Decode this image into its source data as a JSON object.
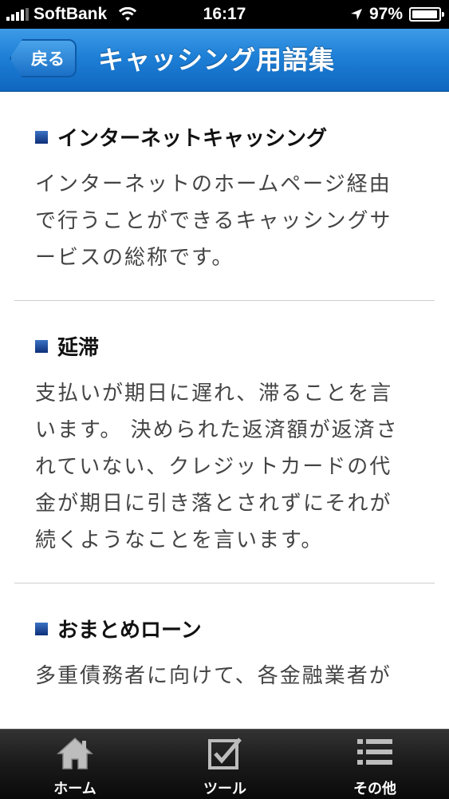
{
  "status_bar": {
    "carrier": "SoftBank",
    "time": "16:17",
    "battery": "97%",
    "battery_level": 0.97
  },
  "nav_bar": {
    "back_label": "戻る",
    "title": "キャッシング用語集"
  },
  "terms": [
    {
      "title": "インターネットキャッシング",
      "lines": [
        "インターネットのホームページ経由",
        "で行うことができるキャッシングサ",
        "ービスの総称です。"
      ]
    },
    {
      "title": "延滞",
      "lines": [
        "支払いが期日に遅れ、滞ることを言",
        "います。 決められた返済額が返済さ",
        "れていない、クレジットカードの代",
        "金が期日に引き落とされずにそれが",
        "続くようなことを言います。"
      ]
    },
    {
      "title": "おまとめローン",
      "lines": [
        "多重債務者に向けて、各金融業者が"
      ]
    }
  ],
  "tab_bar": {
    "items": [
      {
        "label": "ホーム",
        "icon": "home-icon"
      },
      {
        "label": "ツール",
        "icon": "checkbox-icon"
      },
      {
        "label": "その他",
        "icon": "list-icon"
      }
    ]
  },
  "colors": {
    "nav_blue": "#1e7fd6",
    "bullet_blue": "#1f4fa0",
    "tab_bar": "#1a1a1a"
  }
}
